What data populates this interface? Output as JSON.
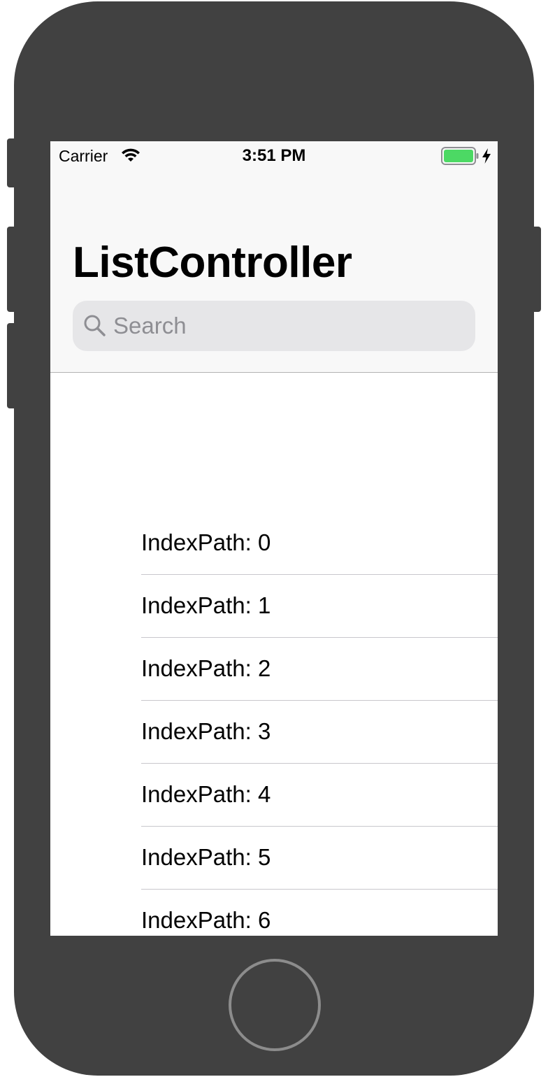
{
  "status_bar": {
    "carrier": "Carrier",
    "time": "3:51 PM",
    "icons": [
      "wifi-icon",
      "battery-icon",
      "charging-bolt-icon"
    ],
    "battery_color": "#4cd964"
  },
  "navbar": {
    "title": "ListController",
    "search": {
      "placeholder": "Search",
      "value": ""
    }
  },
  "list": {
    "items": [
      {
        "label": "IndexPath: 0"
      },
      {
        "label": "IndexPath: 1"
      },
      {
        "label": "IndexPath: 2"
      },
      {
        "label": "IndexPath: 3"
      },
      {
        "label": "IndexPath: 4"
      },
      {
        "label": "IndexPath: 5"
      },
      {
        "label": "IndexPath: 6"
      }
    ]
  },
  "colors": {
    "device_body": "#414141",
    "navbar_bg": "#f8f8f8",
    "search_bg": "#e6e6e8",
    "placeholder": "#8e8e93"
  }
}
